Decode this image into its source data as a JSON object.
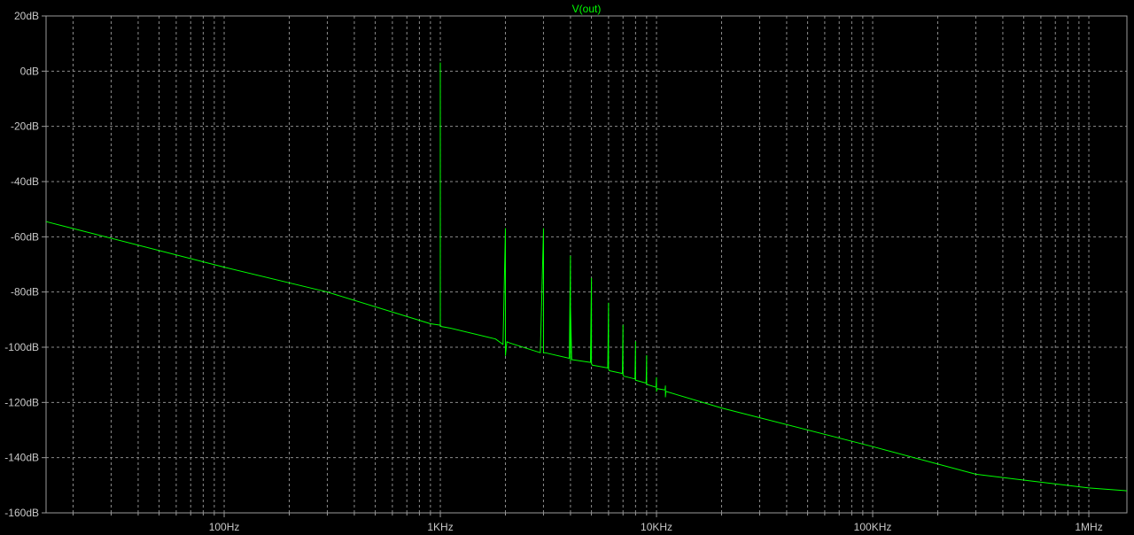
{
  "chart_data": {
    "type": "line",
    "title": "V(out)",
    "xscale": "log",
    "xlim": [
      15,
      1500000
    ],
    "ylim": [
      -160,
      20
    ],
    "y_ticks": [
      {
        "value": 20,
        "label": "20dB"
      },
      {
        "value": 0,
        "label": "0dB"
      },
      {
        "value": -20,
        "label": "-20dB"
      },
      {
        "value": -40,
        "label": "-40dB"
      },
      {
        "value": -60,
        "label": "-60dB"
      },
      {
        "value": -80,
        "label": "-80dB"
      },
      {
        "value": -100,
        "label": "-100dB"
      },
      {
        "value": -120,
        "label": "-120dB"
      },
      {
        "value": -140,
        "label": "-140dB"
      },
      {
        "value": -160,
        "label": "-160dB"
      }
    ],
    "x_ticks": [
      {
        "value": 100,
        "label": "100Hz"
      },
      {
        "value": 1000,
        "label": "1KHz"
      },
      {
        "value": 10000,
        "label": "10KHz"
      },
      {
        "value": 100000,
        "label": "100KHz"
      },
      {
        "value": 1000000,
        "label": "1MHz"
      }
    ],
    "grid": true,
    "colors": {
      "background": "#000000",
      "trace": "#00ff00",
      "grid": "#8c8c8c",
      "text": "#c8c8c8"
    },
    "series": [
      {
        "name": "V(out)",
        "x": [
          15,
          100,
          300,
          900,
          1000,
          1000,
          1000,
          1010,
          1100,
          1800,
          1950,
          2000,
          2000,
          2030,
          2100,
          2900,
          3000,
          3000,
          3050,
          3950,
          4000,
          4000,
          4000,
          4050,
          4950,
          5000,
          5000,
          5050,
          5950,
          6000,
          6000,
          6050,
          6950,
          7000,
          7000,
          7050,
          7950,
          8000,
          8000,
          8050,
          8950,
          9000,
          9000,
          9050,
          9950,
          10000,
          10000,
          10050,
          10950,
          11000,
          11000,
          11050,
          20000,
          100000,
          300000,
          1000000,
          1500000
        ],
        "y": [
          -54.5,
          -71,
          -80,
          -91.5,
          -92,
          3,
          -92,
          -92.5,
          -93,
          -97,
          -99,
          -57,
          -103,
          -98,
          -98.5,
          -102,
          -57,
          -102,
          -102,
          -104,
          -67,
          -105,
          -85,
          -104.5,
          -105.5,
          -75,
          -106,
          -106.5,
          -107.5,
          -84,
          -108,
          -108.5,
          -109.5,
          -92,
          -110,
          -110.5,
          -111.5,
          -98,
          -112,
          -112,
          -113,
          -103,
          -113,
          -113.5,
          -114.5,
          -111,
          -116,
          -115,
          -115.5,
          -114,
          -118,
          -116,
          -122,
          -136,
          -146,
          -151,
          -152
        ]
      }
    ]
  }
}
